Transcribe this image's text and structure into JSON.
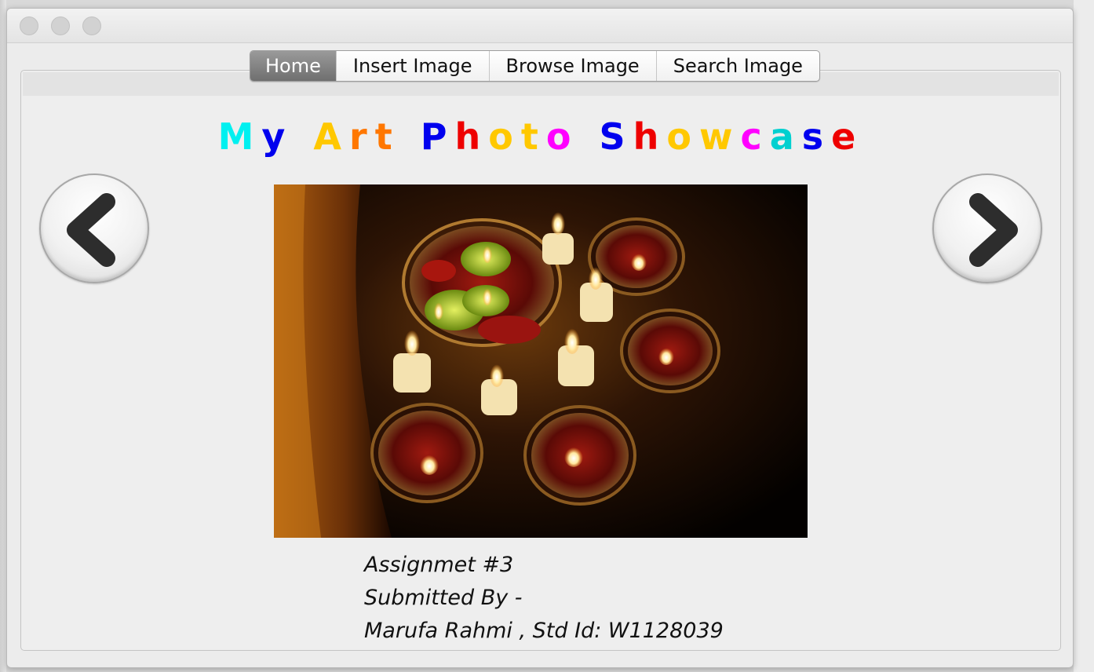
{
  "window": {
    "title": ""
  },
  "tabs": [
    {
      "label": "Home",
      "active": true
    },
    {
      "label": "Insert Image",
      "active": false
    },
    {
      "label": "Browse Image",
      "active": false
    },
    {
      "label": "Search Image",
      "active": false
    }
  ],
  "showcase": {
    "title_letters": [
      {
        "ch": "M",
        "color": "#00f0f0"
      },
      {
        "ch": "y",
        "color": "#0000ee"
      },
      {
        "ch": " ",
        "color": "#000000"
      },
      {
        "ch": "A",
        "color": "#ffc800"
      },
      {
        "ch": "r",
        "color": "#ff7700"
      },
      {
        "ch": "t",
        "color": "#ff7700"
      },
      {
        "ch": " ",
        "color": "#000000"
      },
      {
        "ch": "P",
        "color": "#0000ee"
      },
      {
        "ch": "h",
        "color": "#ee0000"
      },
      {
        "ch": "o",
        "color": "#ffc800"
      },
      {
        "ch": "t",
        "color": "#ffc800"
      },
      {
        "ch": "o",
        "color": "#ff00ff"
      },
      {
        "ch": " ",
        "color": "#000000"
      },
      {
        "ch": "S",
        "color": "#0000ee"
      },
      {
        "ch": "h",
        "color": "#ee0000"
      },
      {
        "ch": "o",
        "color": "#ffc800"
      },
      {
        "ch": "w",
        "color": "#ffc800"
      },
      {
        "ch": "c",
        "color": "#ff00ff"
      },
      {
        "ch": "a",
        "color": "#00d0d0"
      },
      {
        "ch": "s",
        "color": "#0000ee"
      },
      {
        "ch": "e",
        "color": "#ee0000"
      }
    ]
  },
  "navigation": {
    "prev_icon": "chevron-left-icon",
    "next_icon": "chevron-right-icon"
  },
  "photo": {
    "subject": "candles-and-rose-petals-photo"
  },
  "caption": {
    "line1": "Assignmet #3",
    "line2": "Submitted By -",
    "line3": "Marufa Rahmi , Std Id: W1128039"
  }
}
